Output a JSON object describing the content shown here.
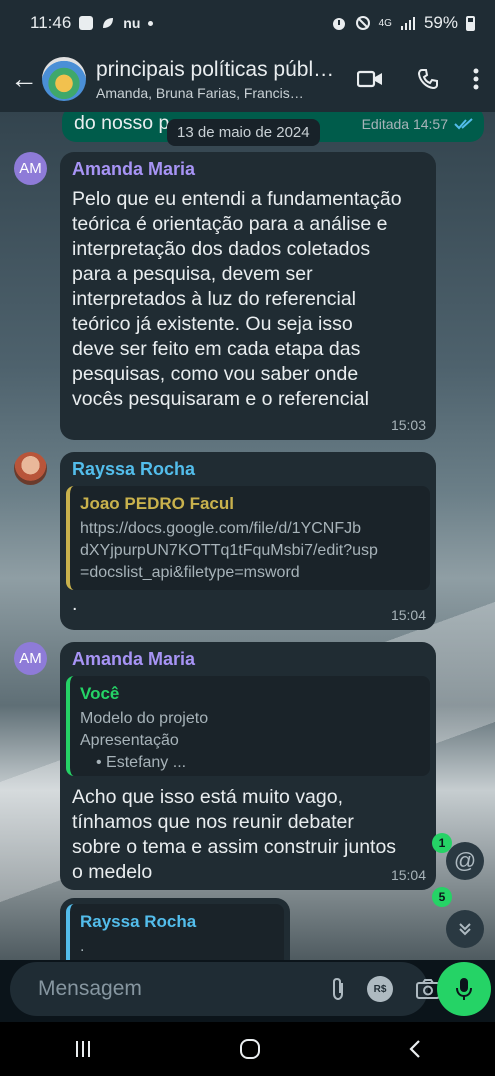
{
  "status_bar": {
    "time": "11:46",
    "icons_left": [
      "image-icon",
      "leaf-icon",
      "nu-icon"
    ],
    "nu_label": "nu",
    "network": "4G",
    "battery": "59%"
  },
  "header": {
    "title": "principais políticas públ…",
    "subtitle": "Amanda, Bruna Farias, Francis…",
    "icons": [
      "video-call-icon",
      "voice-call-icon",
      "more-vert-icon"
    ]
  },
  "chat": {
    "date_pill": "13 de maio de 2024",
    "top_fragment": {
      "text": "do nosso p",
      "edited_label": "Editada 14:57"
    },
    "messages": [
      {
        "avatar_initials": "AM",
        "sender": "Amanda Maria",
        "sender_color": "#a794f5",
        "lines": [
          "Pelo que eu entendi a fundamentação",
          "teórica é orientação para a análise e",
          "interpretação dos dados coletados",
          "para a pesquisa, devem ser",
          "interpretados à luz do referencial",
          "teórico já existente. Ou seja isso",
          "deve ser feito em cada etapa das",
          "pesquisas, como vou saber onde",
          "vocês pesquisaram e o referencial"
        ],
        "time": "15:03"
      },
      {
        "sender": "Rayssa Rocha",
        "sender_color": "#53bdeb",
        "quote": {
          "author": "Joao PEDRO Facul",
          "author_color": "#c9b24d",
          "lines": [
            "https://docs.google.com/file/d/1YCNFJb",
            "dXYjpurpUN7KOTTq1tFquMsbi7/edit?usp",
            "=docslist_api&filetype=msword"
          ]
        },
        "text": ".",
        "time": "15:04"
      },
      {
        "avatar_initials": "AM",
        "sender": "Amanda Maria",
        "sender_color": "#a794f5",
        "quote": {
          "author": "Você",
          "author_color": "#25d366",
          "lines": [
            "Modelo do projeto",
            "Apresentação",
            "• Estefany ..."
          ]
        },
        "lines": [
          "Acho que isso está muito vago,",
          "tínhamos que nos reunir debater",
          "sobre o tema e assim construir juntos",
          "o medelo"
        ],
        "time": "15:04"
      },
      {
        "sender": "Rayssa Rocha",
        "sender_color": "#53bdeb",
        "text": "."
      }
    ],
    "mentions_badge": "1",
    "unread_badge": "5"
  },
  "composer": {
    "placeholder": "Mensagem",
    "rs_label": "R$",
    "icons": [
      "emoji-icon",
      "attach-icon",
      "payment-icon",
      "camera-icon",
      "mic-icon"
    ]
  },
  "nav": {
    "icons": [
      "recent-apps-icon",
      "home-icon",
      "back-nav-icon"
    ]
  },
  "colors": {
    "incoming_bubble": "#202c33",
    "outgoing_bubble": "#005c4b",
    "accent": "#25d366"
  }
}
